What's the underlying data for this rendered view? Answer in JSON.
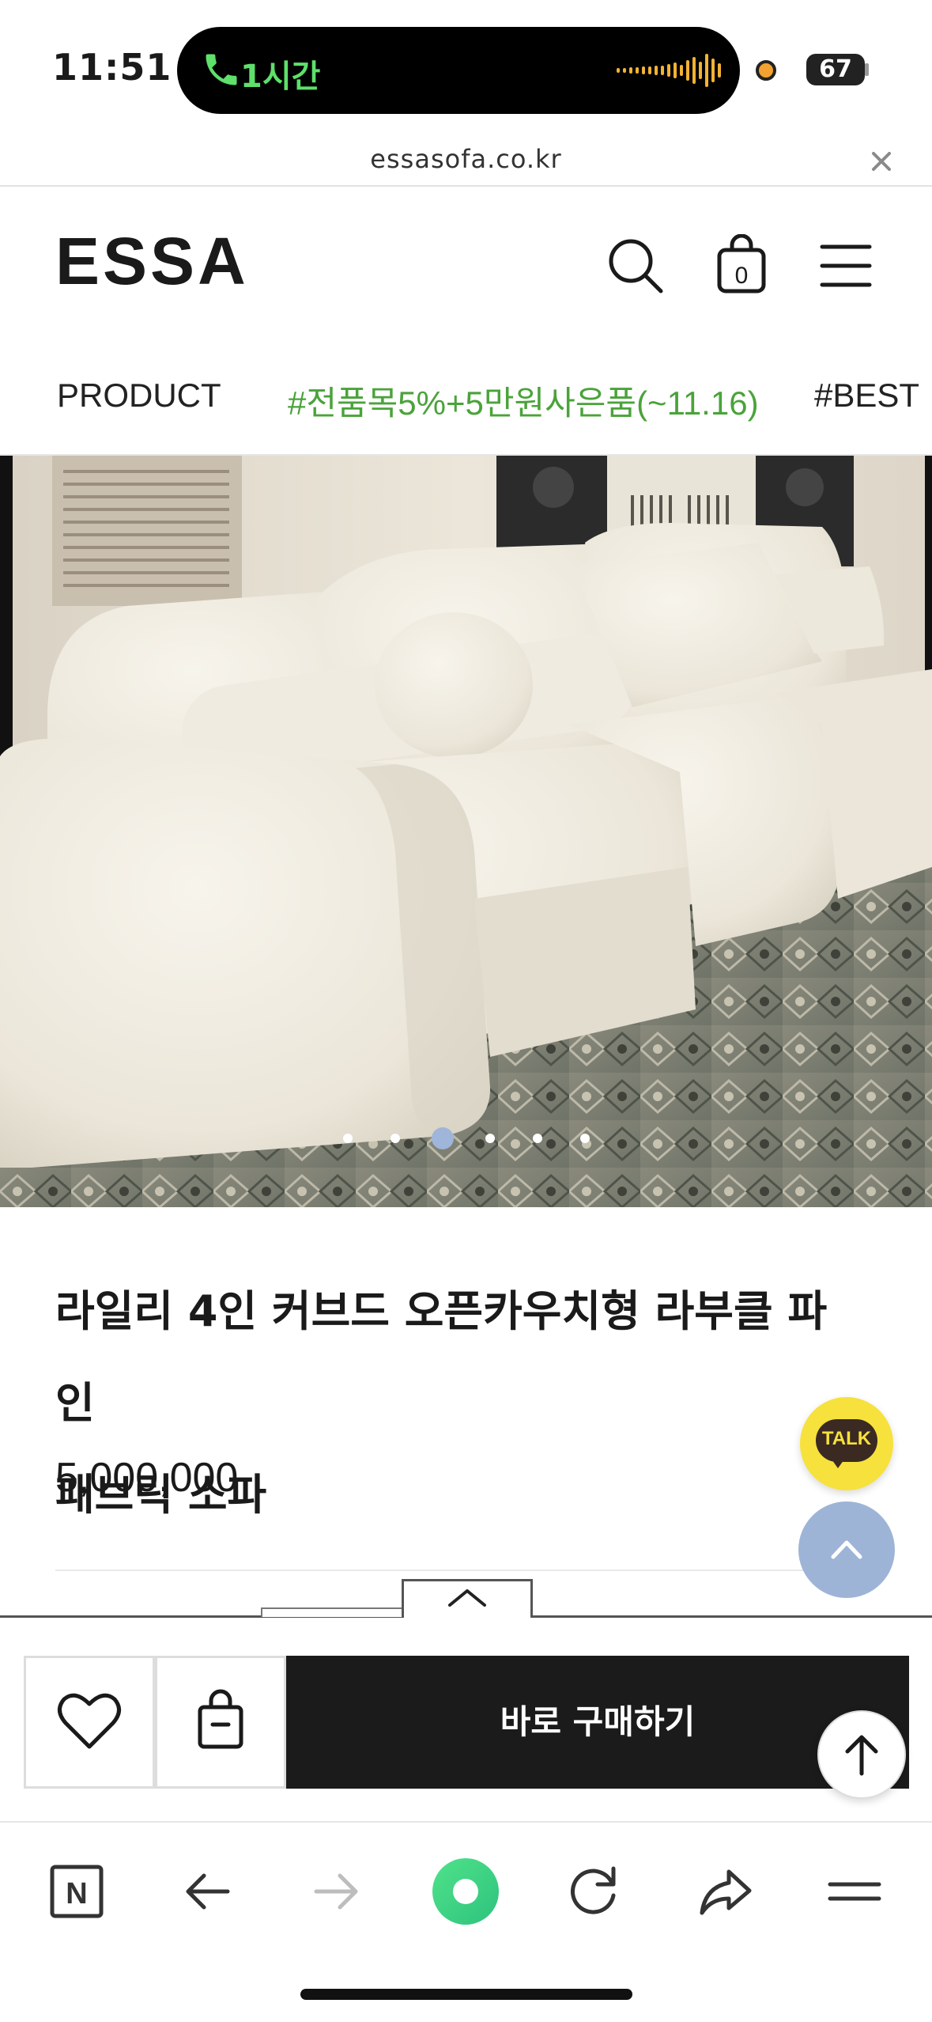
{
  "status_bar": {
    "time": "11:51",
    "call_label": "1시간",
    "battery": "67",
    "call_color": "#5ee06a"
  },
  "browser": {
    "url": "essasofa.co.kr",
    "close_icon": "close-icon"
  },
  "header": {
    "logo": "ESSA",
    "cart_count": "0",
    "icons": [
      "search-icon",
      "cart-icon",
      "menu-icon"
    ]
  },
  "categories": [
    {
      "label": "PRODUCT",
      "color": "#222222"
    },
    {
      "label": "#전품목5%+5만원사은품(~11.16)",
      "color": "#4aa33a"
    },
    {
      "label": "#BEST",
      "color": "#222222"
    }
  ],
  "gallery": {
    "slide_count": 6,
    "active_index": 2,
    "active_dot_color": "#9fb5d9"
  },
  "product": {
    "title_line1": "라일리 4인 커브드 오픈카우치형 라부클 파인",
    "title_line2": "패브릭 소파",
    "price": "5,000,000"
  },
  "floating": {
    "kakao_label": "TALK",
    "kakao_color": "#f7e13c"
  },
  "action_bar": {
    "buy_label": "바로 구매하기",
    "icons": [
      "heart-icon",
      "shopping-bag-icon",
      "arrow-up-icon"
    ]
  },
  "browser_bar": {
    "naver_label": "N",
    "icons": [
      "naver-home-icon",
      "back-arrow-icon",
      "forward-arrow-icon",
      "green-dot-icon",
      "reload-icon",
      "share-icon",
      "menu-icon"
    ]
  }
}
